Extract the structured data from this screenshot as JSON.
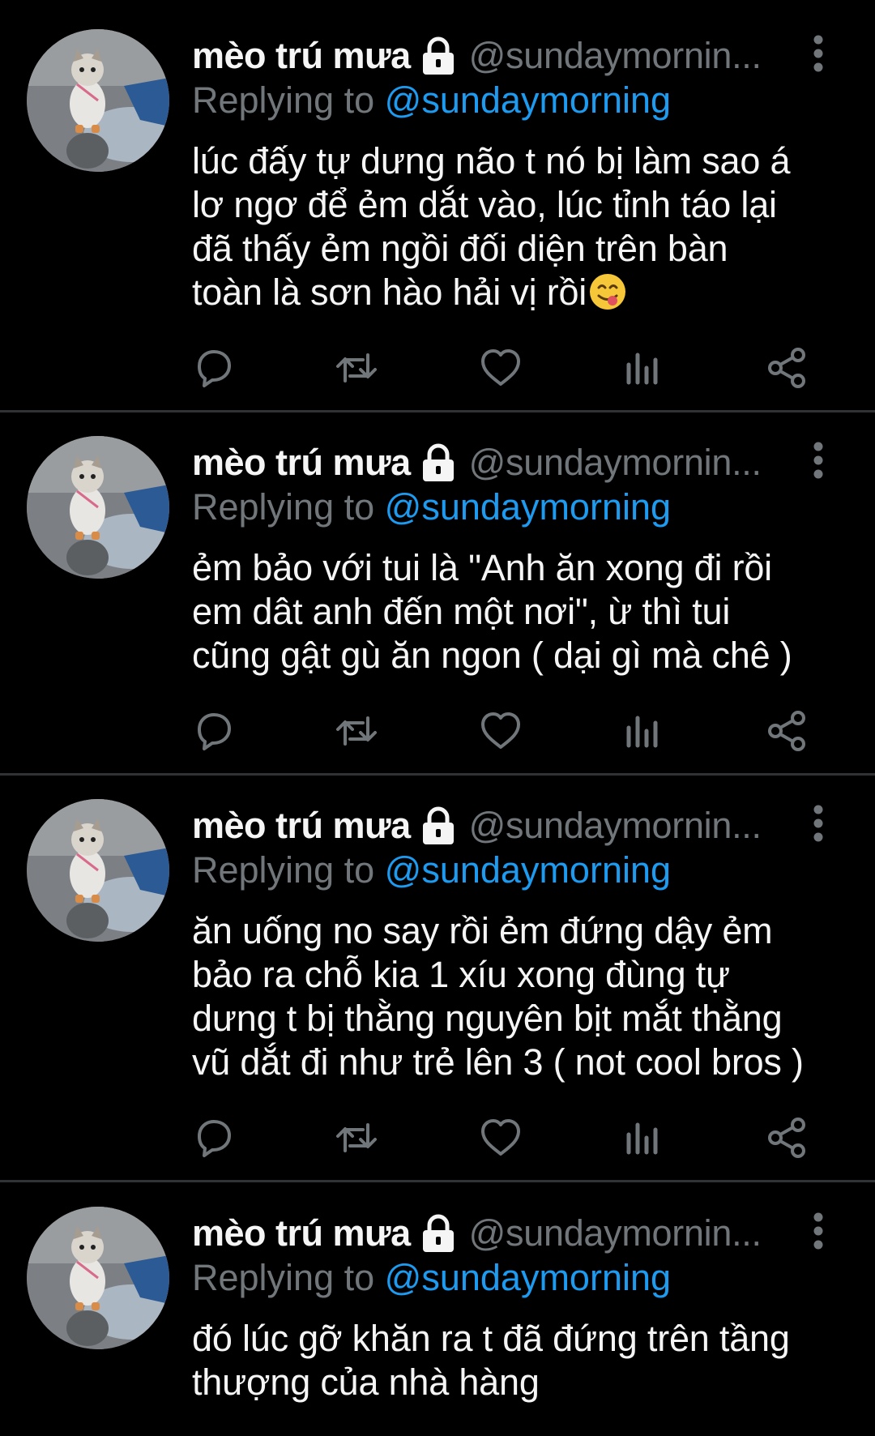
{
  "colors": {
    "background": "#000000",
    "name": "#f5f5f5",
    "muted": "#71767b",
    "link": "#1d9bf0",
    "divider": "#2f3336"
  },
  "icons": {
    "avatar": "cat-avatar",
    "lock": "lock-icon",
    "more": "more-vertical-icon",
    "actions": [
      "reply-icon",
      "retweet-icon",
      "like-icon",
      "analytics-icon",
      "share-icon"
    ]
  },
  "tweets": [
    {
      "name": "mèo trú mưa",
      "handle": "@sundaymornin...",
      "replying_prefix": "Replying to",
      "replying_to": "@sundaymorning",
      "lines": [
        "lúc đấy tự dưng não t nó bị làm sao á",
        "lơ ngơ để ẻm dắt vào, lúc tỉnh táo lại",
        "đã thấy ẻm ngồi đối diện trên bàn",
        "toàn là sơn hào hải vị rồi"
      ],
      "emoji": "yum-face-emoji"
    },
    {
      "name": "mèo trú mưa",
      "handle": "@sundaymornin...",
      "replying_prefix": "Replying to",
      "replying_to": "@sundaymorning",
      "lines": [
        "ẻm bảo với tui là \"Anh ăn xong đi rồi",
        "em dât anh đến một nơi\", ừ thì tui",
        "cũng gật gù ăn ngon ( dại gì mà chê )"
      ]
    },
    {
      "name": "mèo trú mưa",
      "handle": "@sundaymornin...",
      "replying_prefix": "Replying to",
      "replying_to": "@sundaymorning",
      "lines": [
        "ăn uống no say rồi ẻm đứng dậy ẻm",
        "bảo ra chỗ kia 1 xíu xong đùng tự",
        "dưng t bị thằng nguyên bịt mắt thằng",
        "vũ dắt đi như trẻ lên 3 ( not cool bros )"
      ]
    },
    {
      "name": "mèo trú mưa",
      "handle": "@sundaymornin...",
      "replying_prefix": "Replying to",
      "replying_to": "@sundaymorning",
      "lines": [
        "đó lúc gỡ khăn ra t đã đứng trên tầng",
        "thượng của nhà hàng"
      ]
    }
  ]
}
